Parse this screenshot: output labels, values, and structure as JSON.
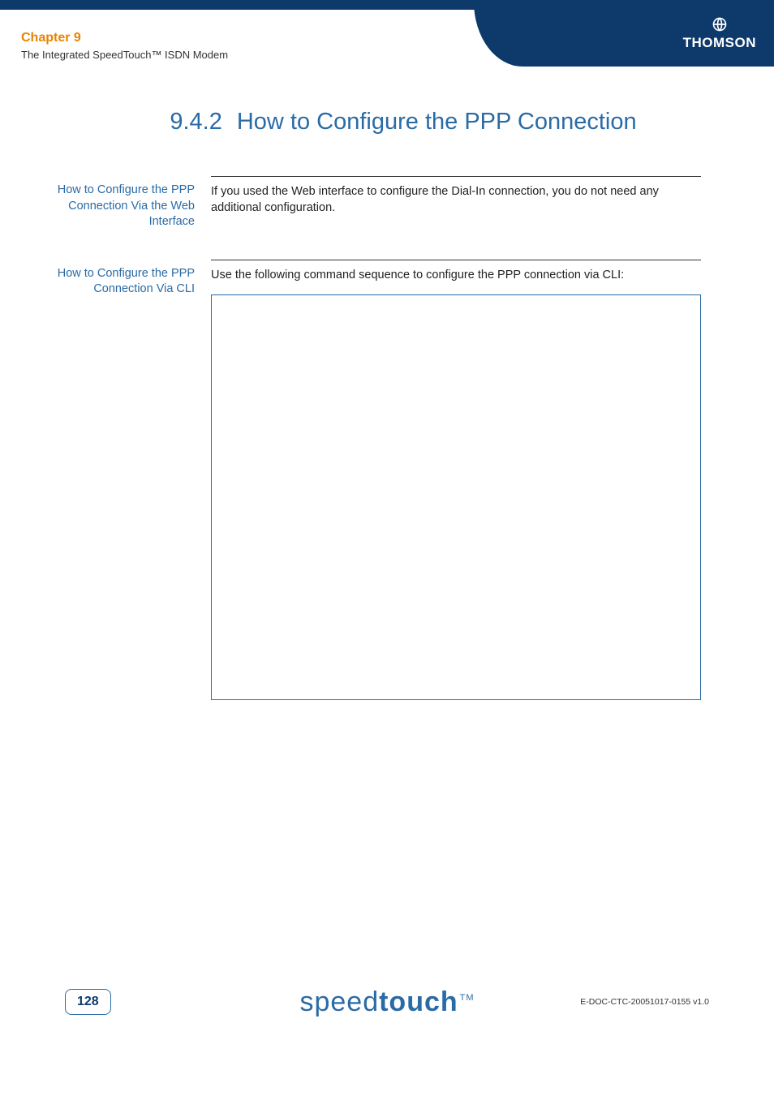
{
  "header": {
    "chapter_label": "Chapter 9",
    "chapter_sub": "The Integrated SpeedTouch™ ISDN Modem",
    "brand": "THOMSON"
  },
  "title": {
    "number": "9.4.2",
    "text": "How to Configure the PPP Connection"
  },
  "sections": [
    {
      "side": "How to Configure the PPP Connection Via the Web Interface",
      "body": "If you used the Web interface to configure the Dial-In connection, you do not need any additional configuration."
    },
    {
      "side": "How to Configure the PPP Connection Via CLI",
      "body": "Use the following command sequence to configure the PPP connection via CLI:"
    }
  ],
  "footer": {
    "page": "128",
    "logo_light": "speed",
    "logo_bold": "touch",
    "logo_tm": "TM",
    "docref": "E-DOC-CTC-20051017-0155 v1.0"
  }
}
